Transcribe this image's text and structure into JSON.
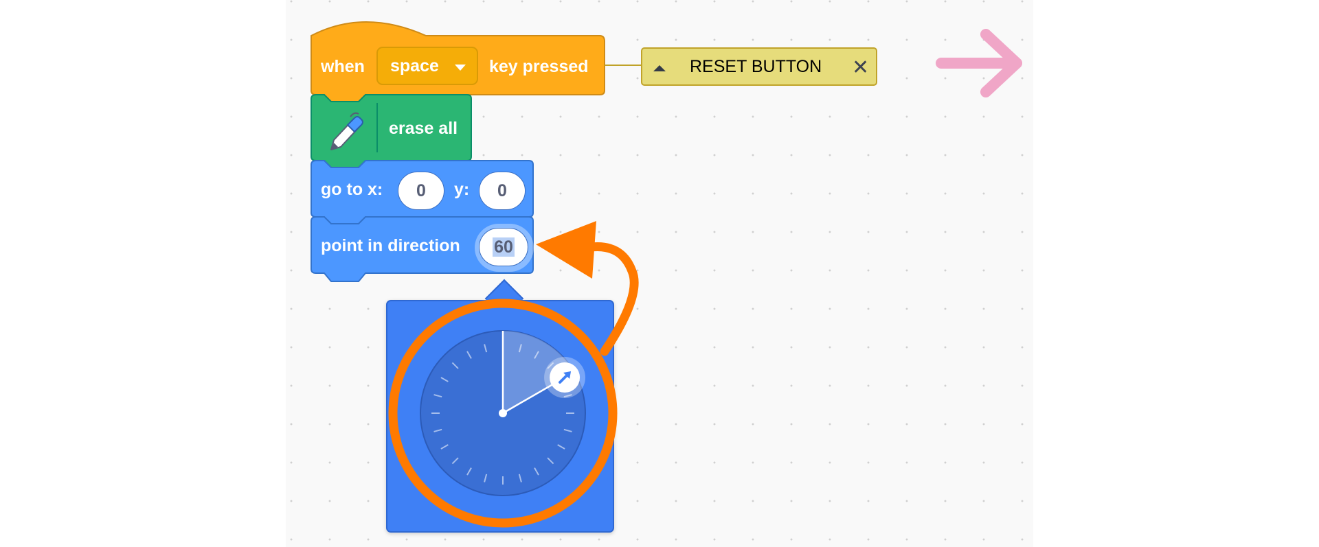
{
  "hat_block": {
    "when_label": "when",
    "key_value": "space",
    "suffix_label": "key pressed",
    "color": "#ffab19"
  },
  "comment": {
    "text": "RESET BUTTON",
    "color": "#e6dc7b"
  },
  "pen_block": {
    "label": "erase all",
    "icon": "pen-icon",
    "color": "#2bb673"
  },
  "goto_block": {
    "label_x": "go to x:",
    "x_value": "0",
    "label_y": "y:",
    "y_value": "0",
    "color": "#4c97ff"
  },
  "direction_block": {
    "label": "point in direction",
    "value": "60",
    "color": "#4c97ff"
  },
  "dial": {
    "direction_degrees": 60,
    "tick_count": 24,
    "icon": "arrow-icon"
  },
  "annotations": {
    "highlight_color": "#ff7a00",
    "arrow_color": "#f0a6c7"
  }
}
